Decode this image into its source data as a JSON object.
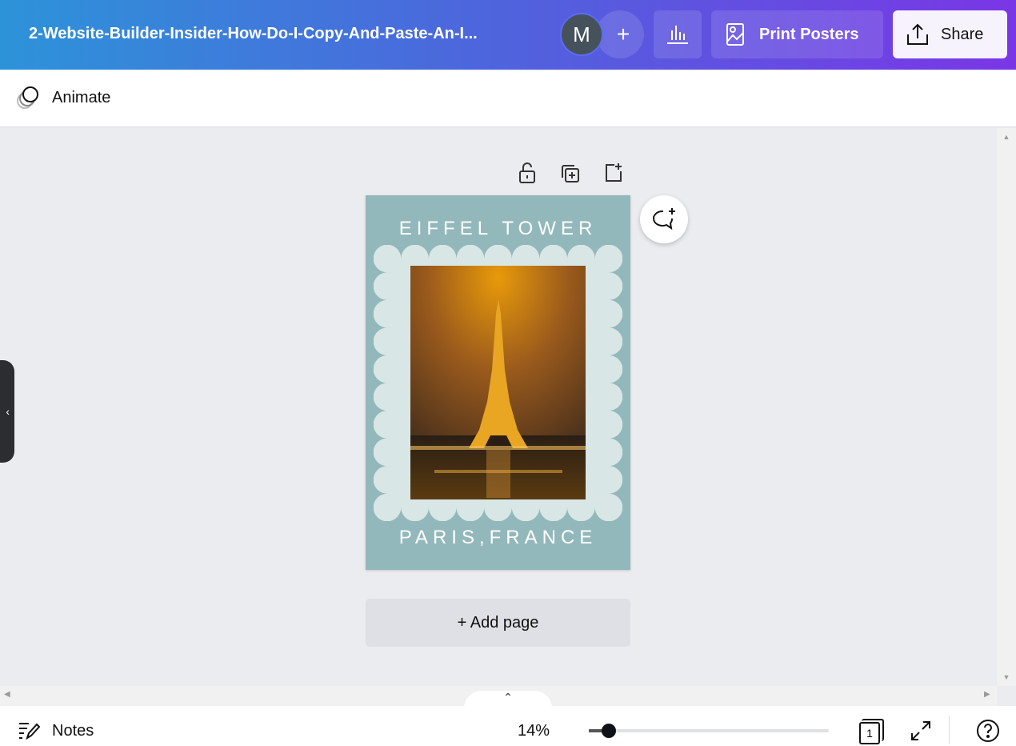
{
  "header": {
    "title": "2-Website-Builder-Insider-How-Do-I-Copy-And-Paste-An-I...",
    "avatar_initial": "M",
    "add_label": "+",
    "print_label": "Print Posters",
    "share_label": "Share"
  },
  "toolbar": {
    "animate_label": "Animate"
  },
  "poster": {
    "top_text": "EIFFEL TOWER",
    "bottom_text": "PARIS,FRANCE",
    "bg_color": "#93b8bb",
    "frame_color": "#d9e6e6"
  },
  "canvas": {
    "add_page_label": "+ Add page"
  },
  "footer": {
    "notes_label": "Notes",
    "zoom": "14%",
    "zoom_value_percent": 14,
    "page_count": "1"
  }
}
